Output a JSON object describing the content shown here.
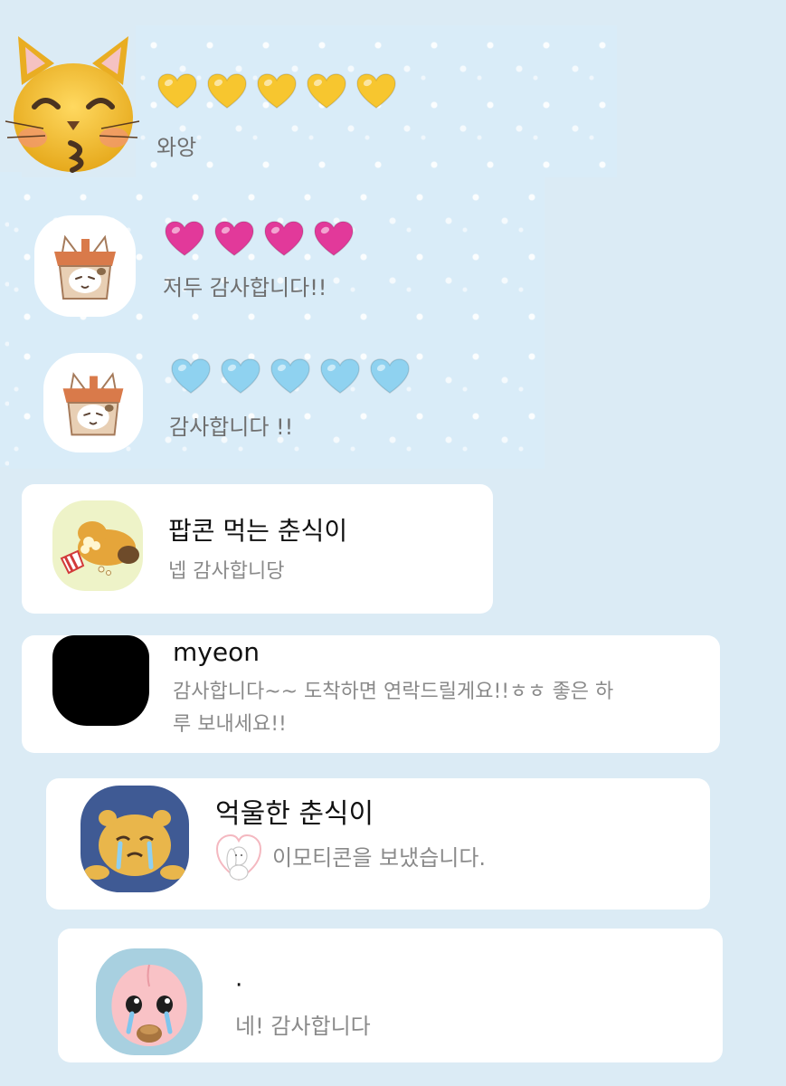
{
  "page": {
    "background_color": "#dbebf5"
  },
  "heart_rows": [
    {
      "color": "#f7c62f",
      "count": 5,
      "message": "와앙",
      "avatar_icon": "cat-kiss-emoji-icon"
    },
    {
      "color": "#e2399a",
      "count": 4,
      "message": "저두 감사합니다!!",
      "avatar_icon": "cat-in-box-icon"
    },
    {
      "color": "#8fd2f0",
      "count": 5,
      "message": "감사합니다 !!",
      "avatar_icon": "cat-in-box-icon"
    }
  ],
  "cards": [
    {
      "title": "팝콘 먹는 춘식이",
      "text": "넵 감사합니당",
      "avatar_icon": "choonsik-popcorn-icon"
    },
    {
      "title": "myeon",
      "text_line1": "감사합니다~~ 도착하면 연락드릴게요!!ㅎㅎ 좋은 하",
      "text_line2": "루 보내세요!!",
      "avatar_icon": "black-avatar-icon"
    },
    {
      "title": "억울한 춘식이",
      "text": "이모티콘을 보냈습니다.",
      "avatar_icon": "choonsik-crying-icon",
      "inline_icon": "bunny-heart-sticker-icon"
    },
    {
      "title": "·",
      "text": "네! 감사합니다",
      "avatar_icon": "apeach-crying-icon"
    }
  ],
  "colors": {
    "card_background": "#ffffff",
    "title_text": "#111111",
    "secondary_text": "#8a8a8a",
    "panel_background": "#d9ecf8"
  }
}
